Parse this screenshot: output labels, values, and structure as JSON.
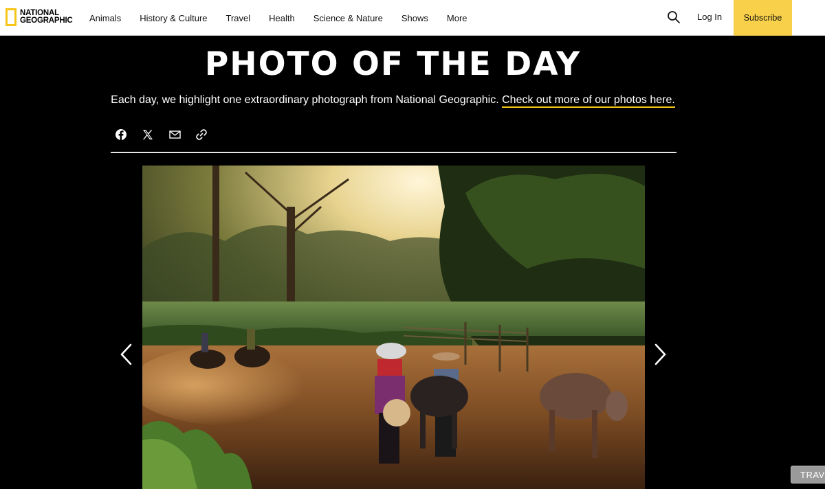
{
  "header": {
    "logo_line1": "NATIONAL",
    "logo_line2": "GEOGRAPHIC",
    "nav": [
      "Animals",
      "History & Culture",
      "Travel",
      "Health",
      "Science & Nature",
      "Shows",
      "More"
    ],
    "search_icon": "search-icon",
    "login_label": "Log In",
    "subscribe_label": "Subscribe",
    "colors": {
      "brand_yellow": "#f5c518",
      "subscribe_bg": "#f8d04a"
    }
  },
  "hero": {
    "title": "PHOTO OF THE DAY",
    "description": "Each day, we highlight one extraordinary photograph from National Geographic.",
    "link_text": "Check out more of our photos here."
  },
  "share": [
    "facebook-icon",
    "x-icon",
    "email-icon",
    "link-icon"
  ],
  "gallery": {
    "prev_icon": "chevron-left-icon",
    "next_icon": "chevron-right-icon"
  },
  "tag": {
    "label": "TRAVE"
  }
}
